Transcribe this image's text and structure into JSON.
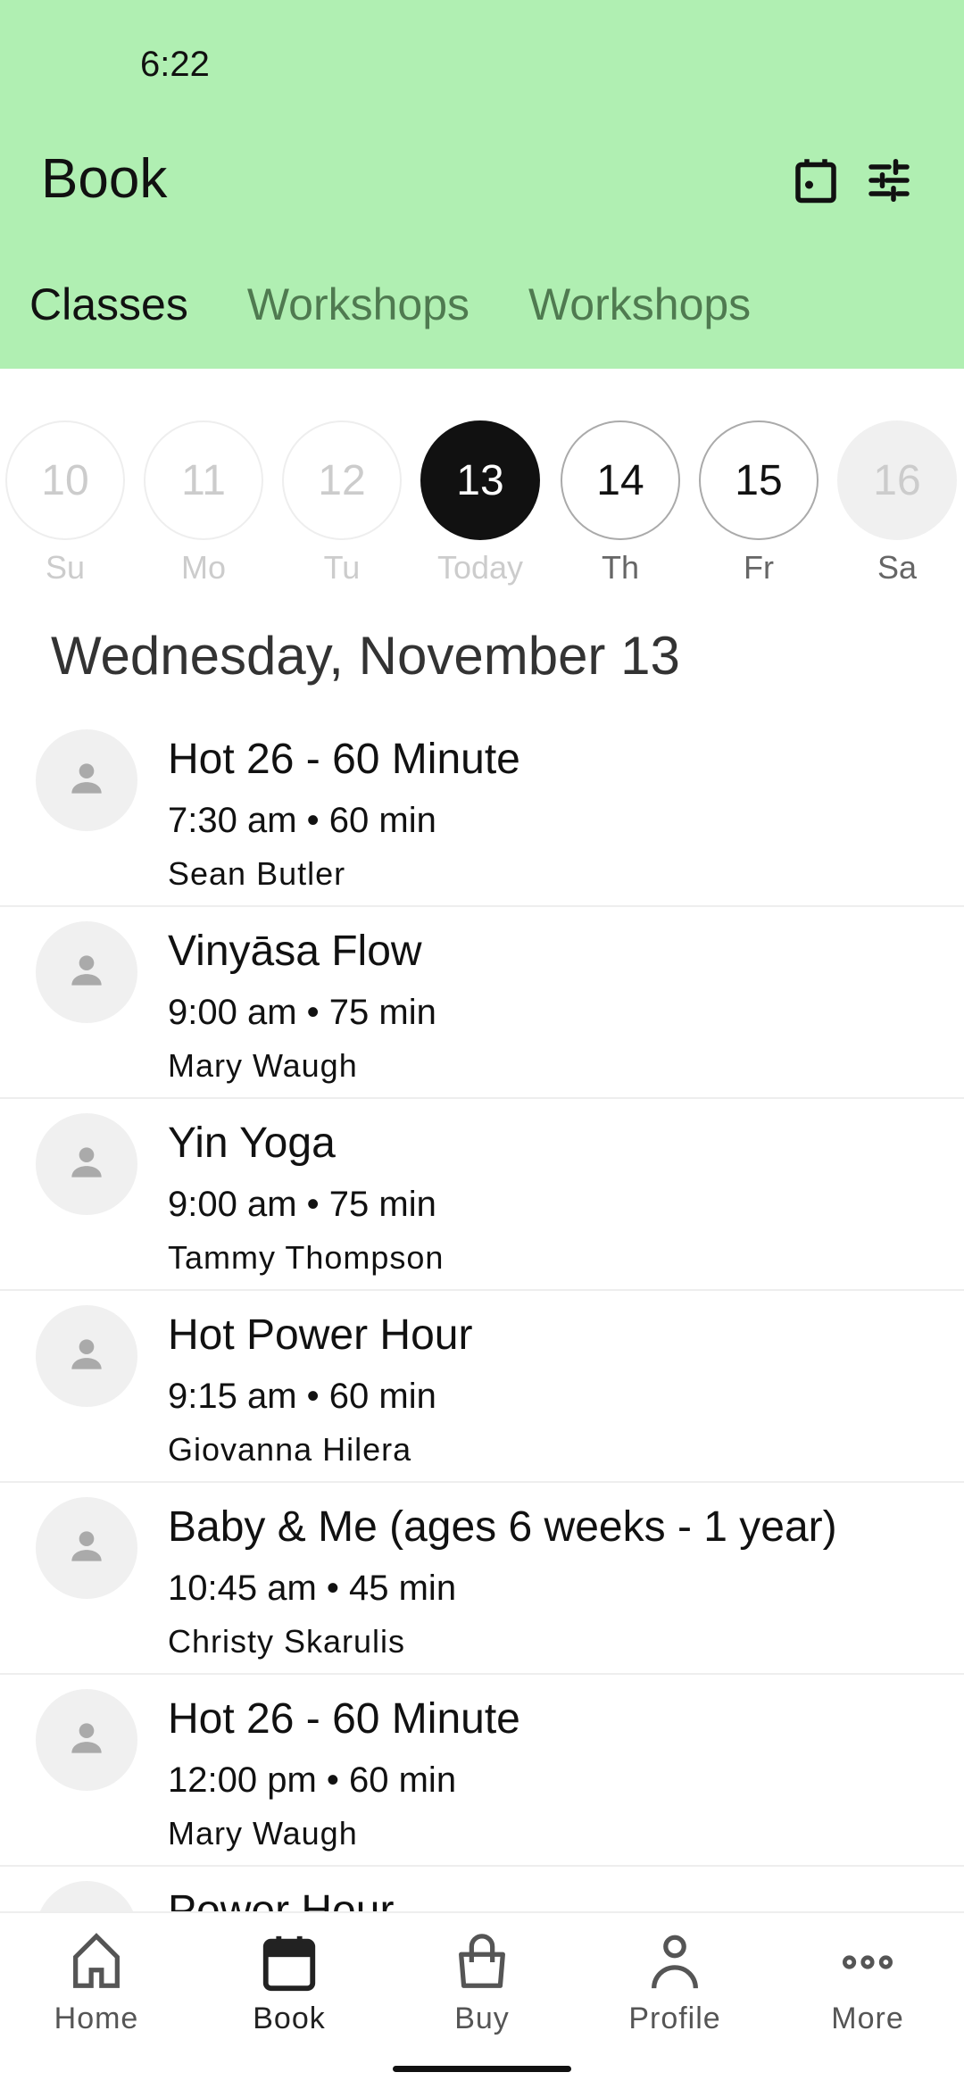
{
  "status": {
    "time": "6:22"
  },
  "header": {
    "title": "Book",
    "icons": [
      "calendar-icon",
      "filter-sliders-icon"
    ],
    "bg_color": "#b0efb2"
  },
  "tabs": [
    {
      "label": "Classes",
      "active": true
    },
    {
      "label": "Workshops"
    },
    {
      "label": "Workshops"
    }
  ],
  "days": [
    {
      "num": "10",
      "label": "Su",
      "state": "past"
    },
    {
      "num": "11",
      "label": "Mo",
      "state": "past"
    },
    {
      "num": "12",
      "label": "Tu",
      "state": "past"
    },
    {
      "num": "13",
      "label": "Today",
      "state": "selected"
    },
    {
      "num": "14",
      "label": "Th",
      "state": "future"
    },
    {
      "num": "15",
      "label": "Fr",
      "state": "future"
    },
    {
      "num": "16",
      "label": "Sa",
      "state": "disabled"
    }
  ],
  "date_heading": "Wednesday, November 13",
  "classes": [
    {
      "name": "Hot 26 - 60 Minute",
      "time": "7:30 am • 60 min",
      "instructor": "Sean Butler"
    },
    {
      "name": "Vinyāsa Flow",
      "time": "9:00 am • 75 min",
      "instructor": "Mary Waugh"
    },
    {
      "name": "Yin Yoga",
      "time": "9:00 am • 75 min",
      "instructor": "Tammy Thompson"
    },
    {
      "name": "Hot Power Hour",
      "time": "9:15 am • 60 min",
      "instructor": "Giovanna Hilera"
    },
    {
      "name": "Baby & Me (ages 6 weeks - 1 year)",
      "time": "10:45 am • 45 min",
      "instructor": "Christy Skarulis"
    },
    {
      "name": "Hot 26 - 60 Minute",
      "time": "12:00 pm • 60 min",
      "instructor": "Mary Waugh"
    },
    {
      "name": "Power Hour",
      "time": "",
      "instructor": ""
    }
  ],
  "nav": [
    {
      "label": "Home",
      "icon": "home-icon"
    },
    {
      "label": "Book",
      "icon": "calendar-icon",
      "active": true
    },
    {
      "label": "Buy",
      "icon": "shopping-bag-icon"
    },
    {
      "label": "Profile",
      "icon": "person-icon"
    },
    {
      "label": "More",
      "icon": "more-dots-icon"
    }
  ]
}
